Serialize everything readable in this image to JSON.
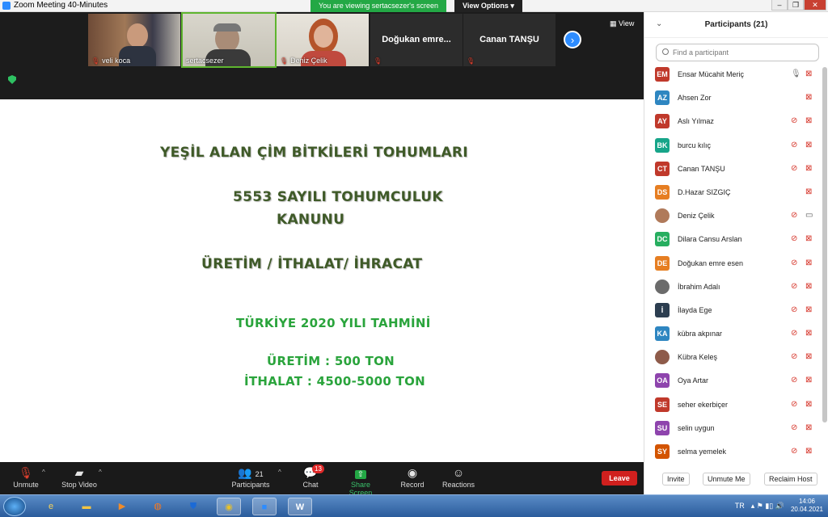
{
  "window": {
    "title": "Zoom Meeting 40-Minutes",
    "min": "–",
    "max": "❐",
    "close": "✕"
  },
  "banner": {
    "text": "You are viewing sertacsezer's screen",
    "view_options": "View Options ▾"
  },
  "thumbs": [
    {
      "name": "veli koca"
    },
    {
      "name": "sertacsezer"
    },
    {
      "name": "Deniz Çelik"
    },
    {
      "name": "Doğukan  emre..."
    },
    {
      "name": "Canan TANŞU"
    }
  ],
  "next_arrow": "›",
  "view_label": "View",
  "slide": {
    "line1": "YEŞİL ALAN ÇİM BİTKİLERİ TOHUMLARI",
    "line2": "5553 SAYILI TOHUMCULUK",
    "line3": "KANUNU",
    "line4": "ÜRETİM / İTHALAT/ İHRACAT",
    "line5": "TÜRKİYE 2020 YILI TAHMİNİ",
    "line6": "ÜRETİM : 500 TON",
    "line7": "İTHALAT : 4500-5000 TON"
  },
  "toolbar": {
    "unmute": "Unmute",
    "stop_video": "Stop Video",
    "participants": "Participants",
    "participants_count": "21",
    "chat": "Chat",
    "chat_badge": "13",
    "share": "Share Screen",
    "record": "Record",
    "reactions": "Reactions",
    "leave": "Leave"
  },
  "panel": {
    "title": "Participants (21)",
    "search_placeholder": "Find a participant",
    "participants": [
      {
        "initials": "EM",
        "name": "Ensar Mücahit Meriç",
        "color": "#c0392b",
        "mic": "on"
      },
      {
        "initials": "AZ",
        "name": "Ahsen Zor",
        "color": "#2e86c1",
        "mic": "none"
      },
      {
        "initials": "AY",
        "name": "Aslı Yılmaz",
        "color": "#c0392b",
        "mic": "off"
      },
      {
        "initials": "BK",
        "name": "burcu kılıç",
        "color": "#17a589",
        "mic": "off"
      },
      {
        "initials": "CT",
        "name": "Canan TANŞU",
        "color": "#c0392b",
        "mic": "off"
      },
      {
        "initials": "DS",
        "name": "D.Hazar SIZGIÇ",
        "color": "#e67e22",
        "mic": "none"
      },
      {
        "initials": "",
        "name": "Deniz Çelik",
        "color": "#b07a5a",
        "mic": "off",
        "cam": "on"
      },
      {
        "initials": "DC",
        "name": "Dilara Cansu Arslan",
        "color": "#27ae60",
        "mic": "off"
      },
      {
        "initials": "DE",
        "name": "Doğukan emre esen",
        "color": "#e67e22",
        "mic": "off"
      },
      {
        "initials": "",
        "name": "İbrahim Adalı",
        "color": "#6b6b6b",
        "mic": "off"
      },
      {
        "initials": "İ",
        "name": "İlayda Ege",
        "color": "#2c3e50",
        "mic": "off"
      },
      {
        "initials": "KA",
        "name": "kübra akpınar",
        "color": "#2e86c1",
        "mic": "off"
      },
      {
        "initials": "",
        "name": "Kübra Keleş",
        "color": "#8e5b4a",
        "mic": "off"
      },
      {
        "initials": "OA",
        "name": "Oya Artar",
        "color": "#8e44ad",
        "mic": "off"
      },
      {
        "initials": "SE",
        "name": "seher ekerbiçer",
        "color": "#c0392b",
        "mic": "off"
      },
      {
        "initials": "SU",
        "name": "selin uygun",
        "color": "#8e44ad",
        "mic": "off"
      },
      {
        "initials": "SY",
        "name": "selma yemelek",
        "color": "#d35400",
        "mic": "off"
      }
    ],
    "invite": "Invite",
    "unmute_me": "Unmute Me",
    "reclaim": "Reclaim Host"
  },
  "taskbar": {
    "lang": "TR",
    "time": "14:06",
    "date": "20.04.2021"
  }
}
